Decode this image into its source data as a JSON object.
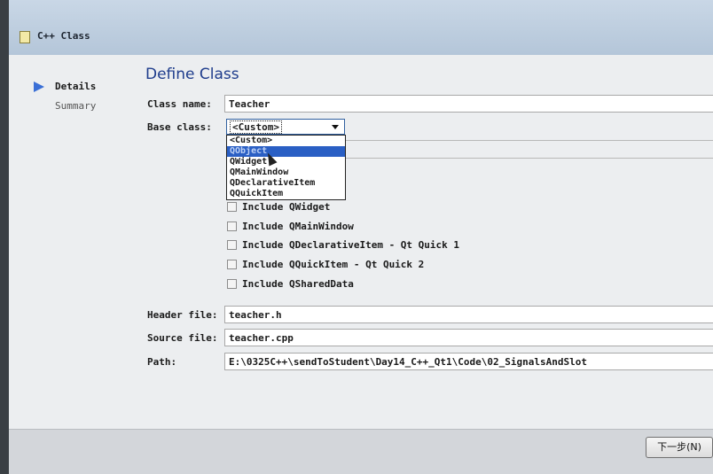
{
  "window": {
    "title": "C++ Class"
  },
  "nav": {
    "items": [
      {
        "label": "Details",
        "active": true
      },
      {
        "label": "Summary",
        "active": false
      }
    ]
  },
  "page": {
    "title": "Define Class"
  },
  "form": {
    "class_name_label": "Class name:",
    "class_name_value": "Teacher",
    "base_class_label": "Base class:",
    "base_class_value": "<Custom>",
    "base_class_options": [
      "<Custom>",
      "QObject",
      "QWidget",
      "QMainWindow",
      "QDeclarativeItem",
      "QQuickItem"
    ],
    "highlighted_option": "QObject",
    "checkboxes": [
      {
        "label": "Include QWidget",
        "checked": false
      },
      {
        "label": "Include QMainWindow",
        "checked": false
      },
      {
        "label": "Include QDeclarativeItem - Qt Quick 1",
        "checked": false
      },
      {
        "label": "Include QQuickItem - Qt Quick 2",
        "checked": false
      },
      {
        "label": "Include QSharedData",
        "checked": false
      }
    ],
    "header_file_label": "Header file:",
    "header_file_value": "teacher.h",
    "source_file_label": "Source file:",
    "source_file_value": "teacher.cpp",
    "path_label": "Path:",
    "path_value": "E:\\0325C++\\sendToStudent\\Day14_C++_Qt1\\Code\\02_SignalsAndSlot"
  },
  "footer": {
    "next_label": "下一步(N)"
  },
  "icons": {
    "title": "document-icon",
    "nav_active": "arrow-right-icon",
    "combo": "chevron-down-icon"
  },
  "colors": {
    "accent": "#2a5fc4",
    "title_blue": "#1e3c8c"
  }
}
